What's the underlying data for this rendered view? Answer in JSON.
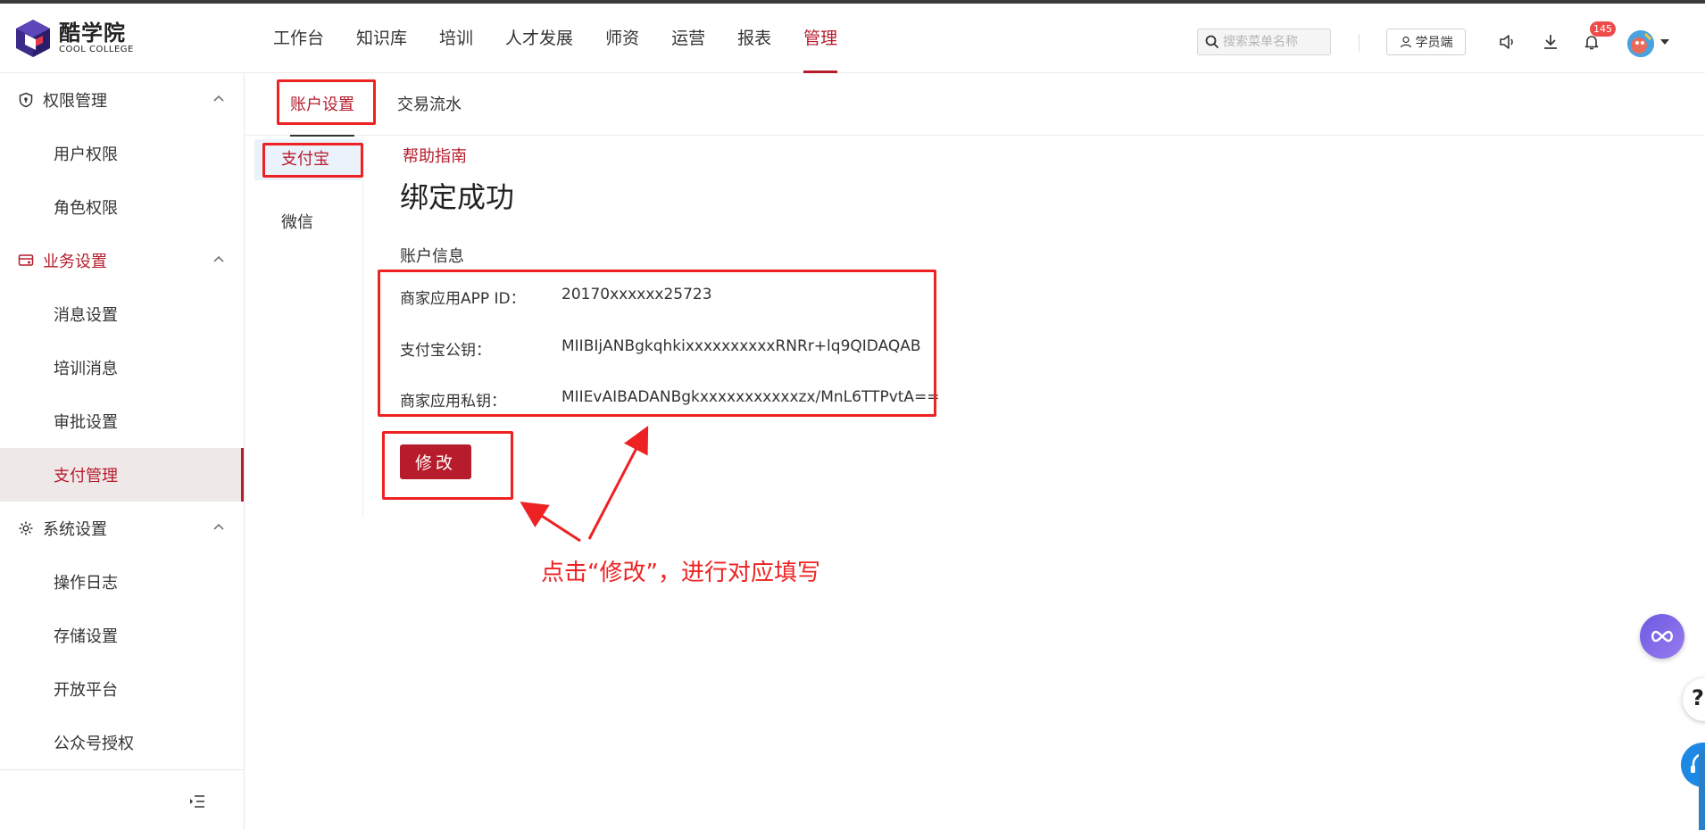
{
  "app": {
    "logo_cn": "酷学院",
    "logo_en": "COOL COLLEGE"
  },
  "nav": {
    "items": [
      "工作台",
      "知识库",
      "培训",
      "人才发展",
      "师资",
      "运营",
      "报表",
      "管理"
    ],
    "active": "管理"
  },
  "header": {
    "search_placeholder": "搜索菜单名称",
    "student_button": "学员端",
    "notification_count": "145"
  },
  "sidebar": {
    "groups": [
      {
        "label": "权限管理",
        "items": [
          "用户权限",
          "角色权限"
        ]
      },
      {
        "label": "业务设置",
        "items": [
          "消息设置",
          "培训消息",
          "审批设置",
          "支付管理"
        ]
      },
      {
        "label": "系统设置",
        "items": [
          "操作日志",
          "存储设置",
          "开放平台",
          "公众号授权"
        ]
      }
    ],
    "active_item": "支付管理"
  },
  "tabs": [
    "账户设置",
    "交易流水"
  ],
  "subnav": [
    "支付宝",
    "微信"
  ],
  "content": {
    "help_link": "帮助指南",
    "status_title": "绑定成功",
    "info_title": "账户信息",
    "fields": [
      {
        "label": "商家应用APP ID：",
        "value": "20170xxxxxx25723"
      },
      {
        "label": "支付宝公钥：",
        "value": "MIIBIjANBgkqhkixxxxxxxxxxRNRr+lq9QIDAQAB"
      },
      {
        "label": "商家应用私钥：",
        "value": "MIIEvAIBADANBgkxxxxxxxxxxxzx/MnL6TTPvtA=="
      }
    ],
    "edit_button": "修改"
  },
  "annotation": {
    "text": "点击“修改”，进行对应填写"
  },
  "colors": {
    "brand": "#b71c2c",
    "annotation": "#ee2222",
    "logo_purple": "#3b2a8a"
  }
}
